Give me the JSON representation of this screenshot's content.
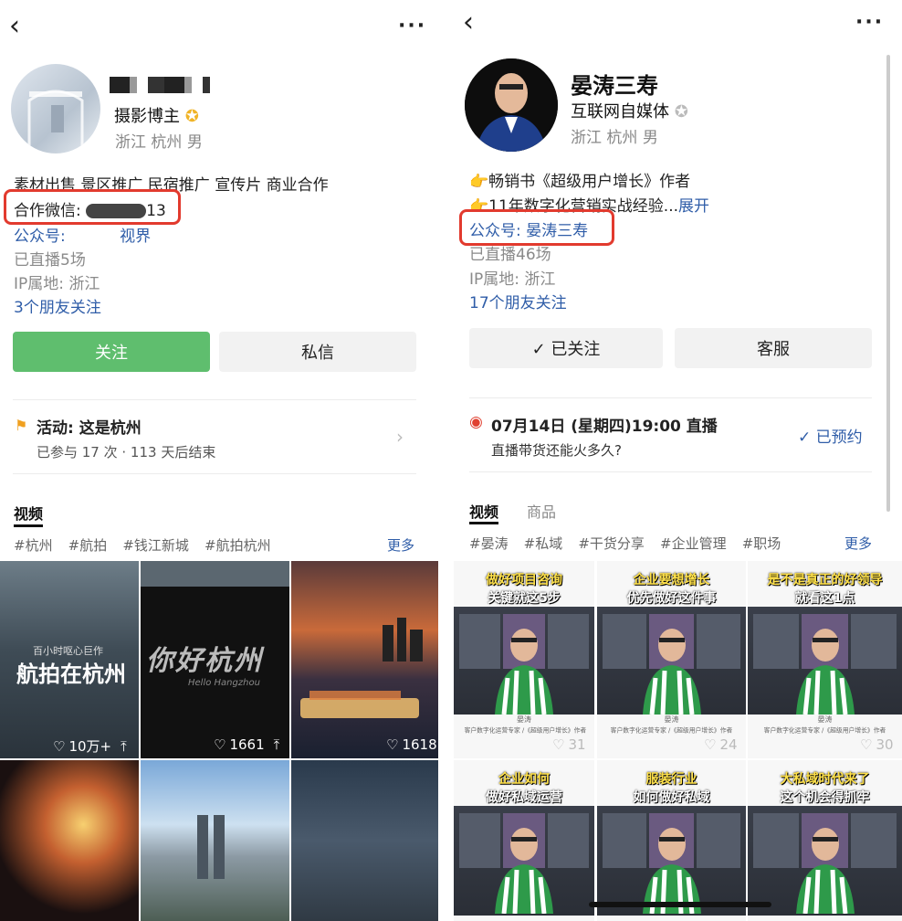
{
  "left": {
    "name_masked": "▆▆ ▆▆",
    "role": "摄影博主",
    "location": "浙江 杭州",
    "gender": "男",
    "bio_line1": "素材出售 景区推广 民宿推广 宣传片 商业合作",
    "wechat_label": "合作微信:",
    "wechat_suffix": "13",
    "gzh_label": "公众号:",
    "gzh_name": "视界",
    "live_count": "已直播5场",
    "ip": "IP属地: 浙江",
    "friends": "3个朋友关注",
    "follow_btn": "关注",
    "msg_btn": "私信",
    "activity_title": "活动: 这是杭州",
    "activity_sub": "已参与 17 次 · 113 天后结束",
    "tab_video": "视频",
    "tags": [
      "#杭州",
      "#航拍",
      "#钱江新城",
      "#航拍杭州"
    ],
    "more": "更多",
    "videos": [
      {
        "title": "航拍在杭州",
        "subtitle": "百小时呕心巨作",
        "likes": "10万+"
      },
      {
        "title": "你好杭州",
        "subtitle": "Hello Hangzhou",
        "likes": "1661"
      },
      {
        "title": "",
        "subtitle": "",
        "likes": "1618"
      },
      {
        "title": "",
        "subtitle": "",
        "likes": ""
      },
      {
        "title": "",
        "subtitle": "",
        "likes": ""
      },
      {
        "title": "",
        "subtitle": "",
        "likes": ""
      }
    ]
  },
  "right": {
    "name": "晏涛三寿",
    "role": "互联网自媒体",
    "location": "浙江 杭州",
    "gender": "男",
    "bio_line1": "👉畅销书《超级用户增长》作者",
    "bio_line2": "👉11年数字化营销实战经验...",
    "expand": "展开",
    "gzh": "公众号: 晏涛三寿",
    "live_count": "已直播46场",
    "ip": "IP属地: 浙江",
    "friends": "17个朋友关注",
    "followed_btn": "✓ 已关注",
    "service_btn": "客服",
    "live_title": "07月14日 (星期四)19:00 直播",
    "live_sub": "直播带货还能火多久?",
    "reserved": "✓ 已预约",
    "tab_video": "视频",
    "tab_goods": "商品",
    "tags": [
      "#晏涛",
      "#私域",
      "#干货分享",
      "#企业管理",
      "#职场"
    ],
    "more": "更多",
    "videos": [
      {
        "line1": "做好项目咨询",
        "line2": "关键就这5步",
        "likes": "31"
      },
      {
        "line1": "企业要想增长",
        "line2": "优先做好这件事",
        "likes": "24"
      },
      {
        "line1": "是不是真正的好领导",
        "line2": "就看这1点",
        "likes": "30"
      },
      {
        "line1": "企业如何",
        "line2": "做好私域运营",
        "likes": ""
      },
      {
        "line1": "服装行业",
        "line2": "如何做好私域",
        "likes": ""
      },
      {
        "line1": "大私域时代来了",
        "line2": "这个机会得抓牢",
        "likes": ""
      }
    ],
    "video_caption_name": "晏涛",
    "video_caption_sub": "客户数字化运营专家 /《超级用户增长》作者"
  },
  "colors": {
    "accent_green": "#5fbe6e",
    "highlight_red": "#e23a2e",
    "link_blue": "#2f5da8",
    "thumb_yellow": "#ffe14a"
  }
}
